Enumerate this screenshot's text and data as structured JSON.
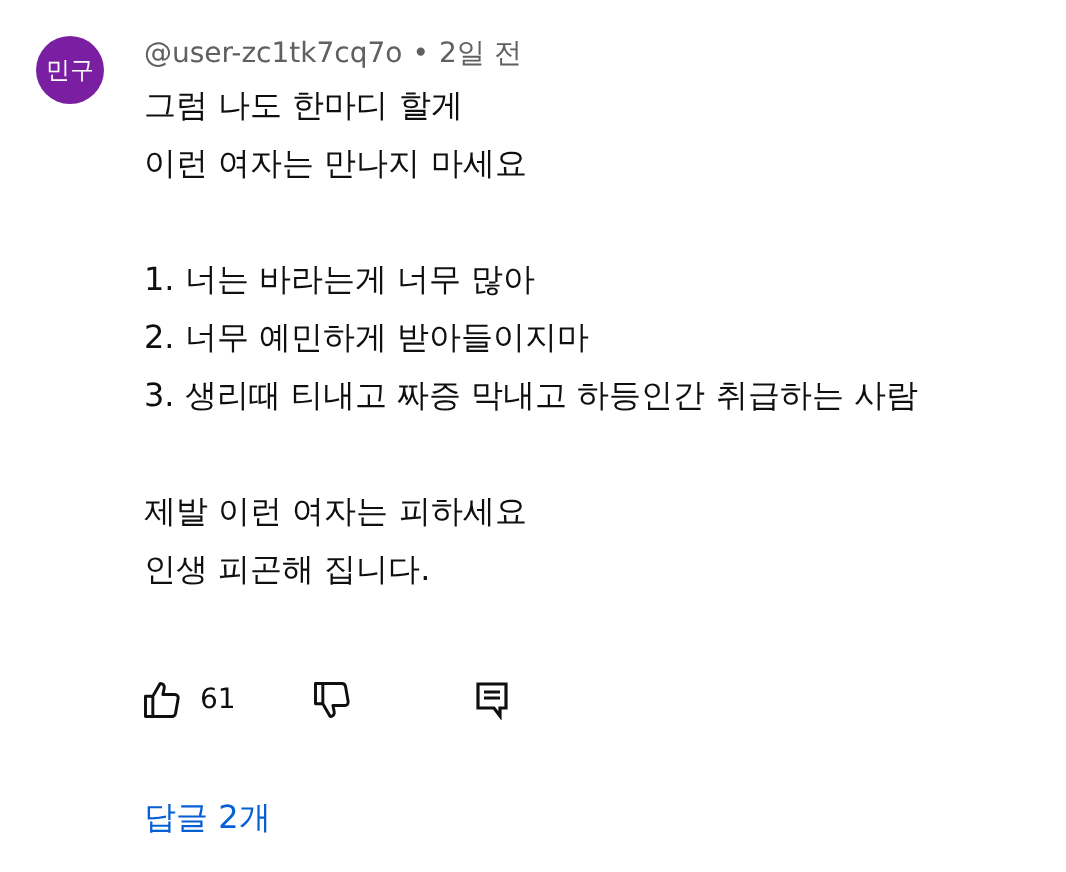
{
  "comment": {
    "avatar": {
      "initials": "민구",
      "color": "#7b1fa2"
    },
    "author": "@user-zc1tk7cq7o",
    "separator": "•",
    "time": "2일 전",
    "paragraphs": [
      [
        "그럼 나도 한마디 할게",
        "이런 여자는 만나지 마세요"
      ],
      [
        "1. 너는 바라는게 너무 많아",
        "2. 너무 예민하게 받아들이지마",
        "3. 생리때 티내고 짜증 막내고 하등인간 취급하는 사람"
      ],
      [
        "제발 이런 여자는 피하세요",
        "인생 피곤해 집니다."
      ]
    ],
    "likes": "61",
    "replies": "답글 2개"
  }
}
